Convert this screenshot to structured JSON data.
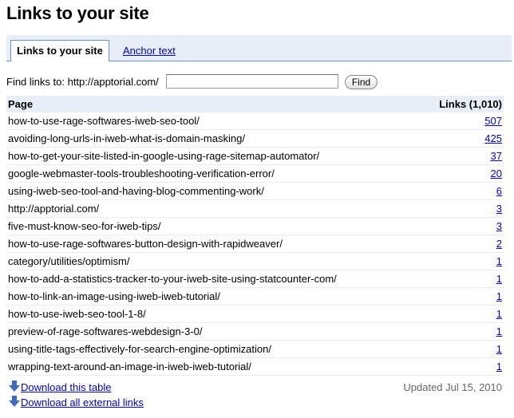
{
  "page": {
    "title": "Links to your site"
  },
  "tabs": [
    {
      "label": "Links to your site",
      "active": true
    },
    {
      "label": "Anchor text",
      "active": false
    }
  ],
  "find": {
    "label": "Find links to: http://apptorial.com/",
    "value": "",
    "placeholder": "",
    "button_label": "Find"
  },
  "table": {
    "headers": {
      "page": "Page",
      "links": "Links (1,010)"
    },
    "rows": [
      {
        "page": "how-to-use-rage-softwares-iweb-seo-tool/",
        "links": "507"
      },
      {
        "page": "avoiding-long-urls-in-iweb-what-is-domain-masking/",
        "links": "425"
      },
      {
        "page": "how-to-get-your-site-listed-in-google-using-rage-sitemap-automator/",
        "links": "37"
      },
      {
        "page": "google-webmaster-tools-troubleshooting-verification-error/",
        "links": "20"
      },
      {
        "page": "using-iweb-seo-tool-and-having-blog-commenting-work/",
        "links": "6"
      },
      {
        "page": "http://apptorial.com/",
        "links": "3"
      },
      {
        "page": "five-must-know-seo-for-iweb-tips/",
        "links": "3"
      },
      {
        "page": "how-to-use-rage-softwares-button-design-with-rapidweaver/",
        "links": "2"
      },
      {
        "page": "category/utilities/optimism/",
        "links": "1"
      },
      {
        "page": "how-to-add-a-statistics-tracker-to-your-iweb-site-using-statcounter-com/",
        "links": "1"
      },
      {
        "page": "how-to-link-an-image-using-iweb-iweb-tutorial/",
        "links": "1"
      },
      {
        "page": "how-to-use-iweb-seo-tool-1-8/",
        "links": "1"
      },
      {
        "page": "preview-of-rage-softwares-webdesign-3-0/",
        "links": "1"
      },
      {
        "page": "using-title-tags-effectively-for-search-engine-optimization/",
        "links": "1"
      },
      {
        "page": "wrapping-text-around-an-image-in-iweb-iweb-tutorial/",
        "links": "1"
      }
    ]
  },
  "footer": {
    "updated": "Updated Jul 15, 2010",
    "download_table": {
      "label": "Download this table",
      "icon": "download-arrow-icon"
    },
    "download_external": {
      "label": "Download all external links",
      "icon": "download-arrow-icon"
    }
  },
  "colors": {
    "link": "#0000cc",
    "tab_bg": "#e8eef7",
    "tab_border": "#6b90da",
    "icon_blue": "#3d6bc4"
  }
}
